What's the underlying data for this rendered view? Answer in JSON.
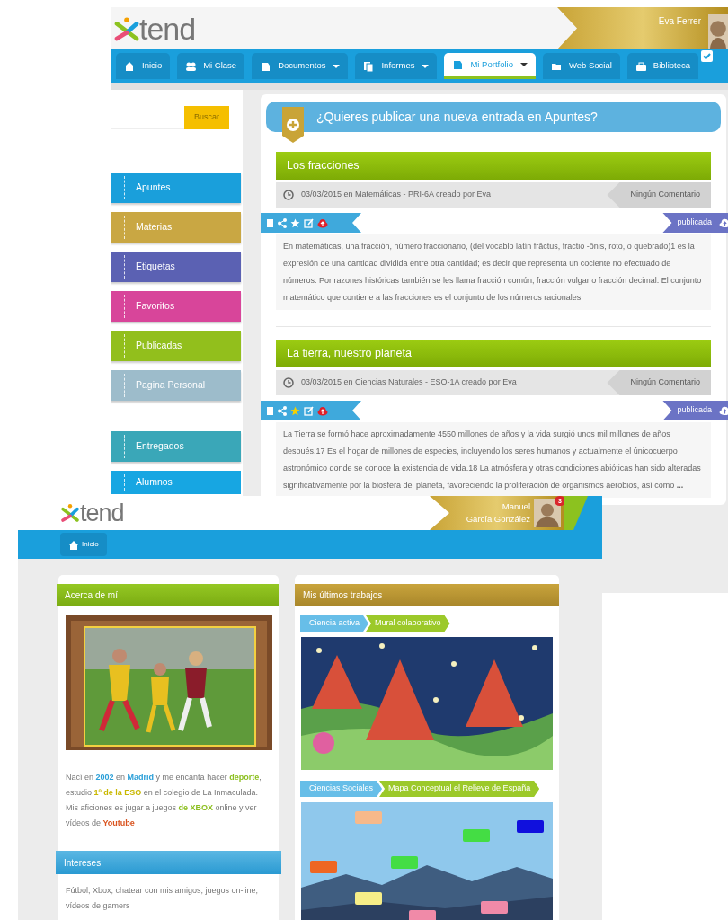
{
  "back_page": {
    "header": {
      "logo": "tend",
      "user_name": "Eva Ferrer"
    },
    "nav": [
      {
        "label": "Inicio",
        "dropdown": false,
        "selected": false
      },
      {
        "label": "Mi Clase",
        "dropdown": false,
        "selected": false
      },
      {
        "label": "Documentos",
        "dropdown": true,
        "selected": false
      },
      {
        "label": "Informes",
        "dropdown": true,
        "selected": false
      },
      {
        "label": "Mi Portfolio",
        "dropdown": true,
        "selected": true
      },
      {
        "label": "Web Social",
        "dropdown": false,
        "selected": false
      },
      {
        "label": "Biblioteca",
        "dropdown": false,
        "selected": false
      }
    ],
    "search": {
      "button": "Buscar"
    },
    "sidebar": [
      {
        "label": "Apuntes",
        "color": "#1a9fdb"
      },
      {
        "label": "Materias",
        "color": "#c9a743"
      },
      {
        "label": "Etiquetas",
        "color": "#5b61b3"
      },
      {
        "label": "Favoritos",
        "color": "#d8459a"
      },
      {
        "label": "Publicadas",
        "color": "#92bf1c"
      },
      {
        "label": "Pagina Personal",
        "color": "#9dbccb"
      },
      {
        "label": "Entregados",
        "color": "#3aa7b8"
      },
      {
        "label": "Alumnos",
        "color": "#17a6e2"
      }
    ],
    "banner": "¿Quieres publicar una nueva entrada en Apuntes?",
    "posts": [
      {
        "title": "Los fracciones",
        "date_line": "03/03/2015 en Matemáticas - PRI-6A creado por Eva",
        "comments": "Ningún Comentario",
        "favorite": false,
        "status": "publicada",
        "text": "En matemáticas, una fracción, número fraccionario, (del vocablo latín frāctus, fractio -ōnis, roto, o quebrado)1 es la expresión de una cantidad dividida entre otra cantidad; es decir que representa un cociente no efectuado de números. Por razones históricas también se les llama fracción común, fracción vulgar o fracción decimal. El conjunto matemático que contiene a las fracciones es el conjunto de los números racionales"
      },
      {
        "title": "La tierra, nuestro planeta",
        "date_line": "03/03/2015 en Ciencias Naturales - ESO-1A creado por Eva",
        "comments": "Ningún Comentario",
        "favorite": true,
        "status": "publicada",
        "text": "La Tierra se formó hace aproximadamente 4550 millones de años y la vida surgió unos mil millones de años después.17 Es el hogar de millones de especies, incluyendo los seres humanos y actualmente el únicocuerpo astronómico donde se conoce la existencia de vida.18 La atmósfera y otras condiciones abióticas han sido alteradas significativamente por la biosfera del planeta, favoreciendo la proliferación de organismos aerobios, así como **...**"
      }
    ]
  },
  "front_page": {
    "header": {
      "logo": "tend",
      "user_first": "Manuel",
      "user_last": "García González",
      "badge": "3"
    },
    "nav": [
      {
        "label": "Inicio",
        "selected": false
      }
    ],
    "about": {
      "title": "Acerca de mí",
      "segments": [
        {
          "text": "Nací en "
        },
        {
          "text": "2002",
          "color": "#2a9fd8"
        },
        {
          "text": " en "
        },
        {
          "text": "Madrid",
          "color": "#2a9fd8"
        },
        {
          "text": " y me encanta hacer "
        },
        {
          "text": "deporte",
          "color": "#8cbf1f"
        },
        {
          "text": ", estudio "
        },
        {
          "text": "1º de la ESO",
          "color": "#c9b800"
        },
        {
          "text": " en el colegio de La Inmaculada. Mis aficiones es jugar a juegos "
        },
        {
          "text": "de XBOX",
          "color": "#8cbf1f"
        },
        {
          "text": " online y ver vídeos de "
        },
        {
          "text": "Youtube",
          "color": "#d9531e"
        }
      ]
    },
    "interests": {
      "title": "Intereses",
      "text": "Fútbol, Xbox, chatear con mis amigos, juegos on-line, vídeos de gamers"
    },
    "works": {
      "title": "Mis últimos trabajos",
      "items": [
        {
          "category": "Ciencia activa",
          "name": "Mural colaborativo",
          "kind": "mural"
        },
        {
          "category": "Ciencias Sociales",
          "name": "Mapa Conceptual el Relieve de España",
          "kind": "map"
        }
      ]
    }
  }
}
